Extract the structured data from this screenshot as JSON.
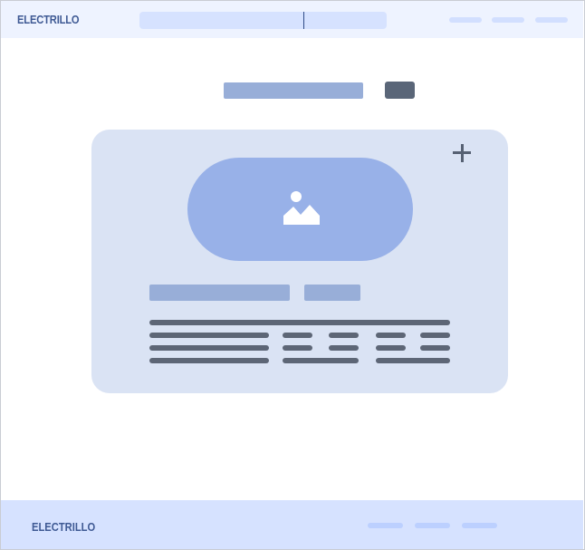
{
  "header": {
    "logo_text": "ELECTRILLO",
    "search_placeholder": "",
    "nav_links": [
      "",
      "",
      ""
    ]
  },
  "search_row": {
    "input_placeholder": "",
    "button_label": ""
  },
  "card": {
    "add_label": "+",
    "image_icon": "image-icon",
    "title": "",
    "tag": "",
    "details": []
  },
  "footer": {
    "logo_text": "ELECTRILLO",
    "links": [
      "",
      "",
      ""
    ]
  },
  "colors": {
    "header_bg": "#eef3ff",
    "search_bg": "#d6e2ff",
    "logo": "#3f5a94",
    "card_bg": "#dae3f4",
    "image_pill": "#98b1e8",
    "placeholder_bar": "#98aed8",
    "dark_line": "#5d6676",
    "button_dark": "#5a6678",
    "footer_bg": "#d6e2ff"
  }
}
